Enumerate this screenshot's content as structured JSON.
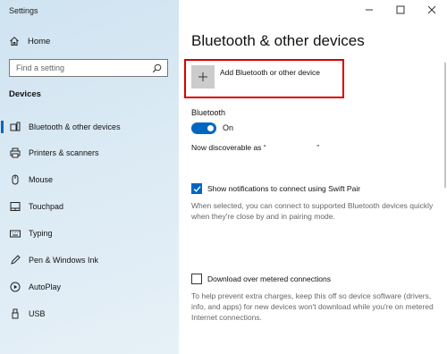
{
  "window": {
    "title": "Settings"
  },
  "sidebar": {
    "home_label": "Home",
    "search_placeholder": "Find a setting",
    "section_label": "Devices",
    "items": [
      {
        "label": "Bluetooth & other devices",
        "icon": "bluetooth-devices-icon",
        "active": true
      },
      {
        "label": "Printers & scanners",
        "icon": "printer-icon"
      },
      {
        "label": "Mouse",
        "icon": "mouse-icon"
      },
      {
        "label": "Touchpad",
        "icon": "touchpad-icon"
      },
      {
        "label": "Typing",
        "icon": "keyboard-icon"
      },
      {
        "label": "Pen & Windows Ink",
        "icon": "pen-icon"
      },
      {
        "label": "AutoPlay",
        "icon": "autoplay-icon"
      },
      {
        "label": "USB",
        "icon": "usb-icon"
      }
    ]
  },
  "main": {
    "title": "Bluetooth & other devices",
    "add_device_label": "Add Bluetooth or other device",
    "add_device_icon": "+",
    "bluetooth_heading": "Bluetooth",
    "toggle_state": "On",
    "discoverable_text": "Now discoverable as “                        ”",
    "swift_pair_label": "Show notifications to connect using Swift Pair",
    "swift_pair_checked": true,
    "swift_pair_desc": "When selected, you can connect to supported Bluetooth devices quickly when they're close by and in pairing mode.",
    "metered_label": "Download over metered connections",
    "metered_checked": false,
    "metered_desc": "To help prevent extra charges, keep this off so device software (drivers, info, and apps) for new devices won't download while you're on metered Internet connections."
  },
  "colors": {
    "accent": "#0067c0",
    "highlight_border": "#d90000",
    "sidebar_bg": "#dbeaf4"
  }
}
